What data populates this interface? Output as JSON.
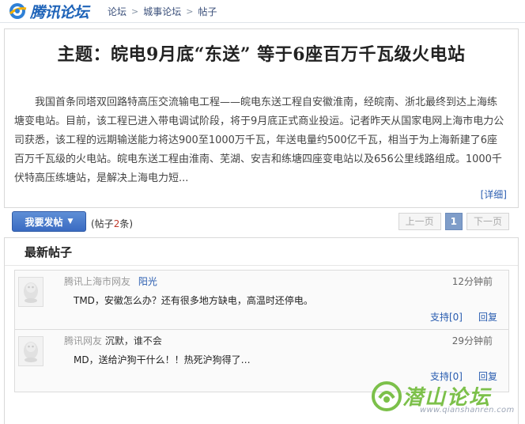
{
  "header": {
    "logo_text": "腾讯论坛",
    "breadcrumb": [
      "论坛",
      "城事论坛",
      "帖子"
    ]
  },
  "thread": {
    "title": "主题：皖电9月底“东送” 等于6座百万千瓦级火电站",
    "summary": "我国首条同塔双回路特高压交流输电工程——皖电东送工程自安徽淮南，经皖南、浙北最终到达上海练塘变电站。目前，该工程已进入带电调试阶段，将于9月底正式商业投运。记者昨天从国家电网上海市电力公司获悉，该工程的远期输送能力将达900至1000万千瓦，年送电量约500亿千瓦，相当于为上海新建了6座百万千瓦级的火电站。皖电东送工程由淮南、芜湖、安吉和练塘四座变电站以及656公里线路组成。1000千伏特高压练塘站，是解决上海电力短...",
    "more_label": "[详细]"
  },
  "actions": {
    "post_button": "我要发帖",
    "count_prefix": "(帖子",
    "count_value": "2",
    "count_suffix": "条)",
    "pager": {
      "prev": "上一页",
      "current": "1",
      "next": "下一页"
    }
  },
  "latest": {
    "heading": "最新帖子",
    "posts": [
      {
        "source": "腾讯上海市网友",
        "user": "阳光",
        "time": "12分钟前",
        "content": "TMD，安徽怎么办？还有很多地方缺电，高温时还停电。",
        "support": "支持[0]",
        "reply": "回复"
      },
      {
        "source": "腾讯网友",
        "user": "沉默，谁不会",
        "time": "29分钟前",
        "content": "MD，送给沪狗干什么！！热死沪狗得了…",
        "support": "支持[0]",
        "reply": "回复"
      }
    ]
  },
  "watermark": {
    "text": "潜山论坛",
    "url": "www.qianshanren.com"
  }
}
